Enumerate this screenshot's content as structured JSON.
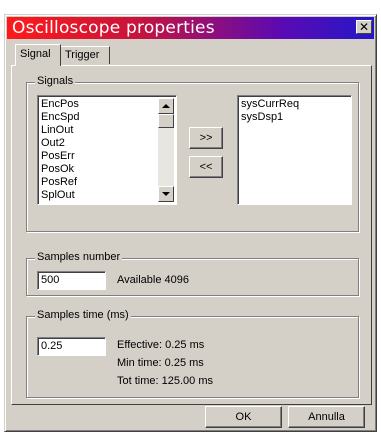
{
  "window": {
    "title": "Oscilloscope properties",
    "close_glyph": "✕"
  },
  "tabs": [
    {
      "label": "Signal",
      "active": true
    },
    {
      "label": "Trigger",
      "active": false
    }
  ],
  "signals": {
    "group_label": "Signals",
    "available": [
      "EncPos",
      "EncSpd",
      "LinOut",
      "Out2",
      "PosErr",
      "PosOk",
      "PosRef",
      "SplOut"
    ],
    "selected": [
      "sysCurrReq",
      "sysDsp1"
    ],
    "add_label": ">>",
    "remove_label": "<<"
  },
  "samples_number": {
    "group_label": "Samples number",
    "value": "500",
    "available_text": "Available 4096"
  },
  "samples_time": {
    "group_label": "Samples time (ms)",
    "value": "0.25",
    "effective_text": "Effective: 0.25 ms",
    "min_text": "Min time: 0.25 ms",
    "tot_text": "Tot time: 125.00 ms"
  },
  "footer": {
    "ok_label": "OK",
    "cancel_label": "Annulla"
  }
}
